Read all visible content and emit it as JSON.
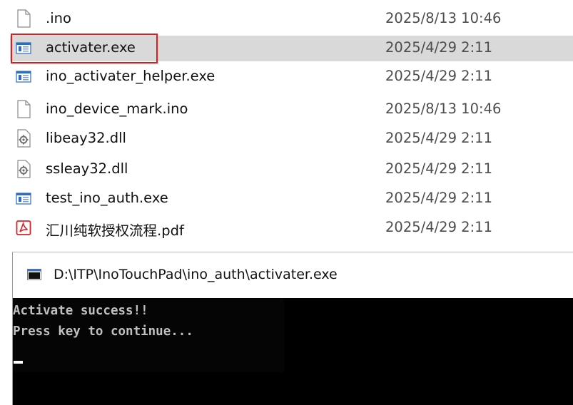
{
  "explorer": {
    "files": [
      {
        "name": ".ino",
        "date": "2025/8/13 10:46",
        "icon": "blank-file-icon"
      },
      {
        "name": "activater.exe",
        "date": "2025/4/29 2:11",
        "icon": "exe-window-icon",
        "selected": true
      },
      {
        "name": "ino_activater_helper.exe",
        "date": "2025/4/29 2:11",
        "icon": "exe-window-icon"
      },
      {
        "name": "ino_device_mark.ino",
        "date": "2025/8/13 10:46",
        "icon": "blank-file-icon"
      },
      {
        "name": "libeay32.dll",
        "date": "2025/4/29 2:11",
        "icon": "dll-gear-icon"
      },
      {
        "name": "ssleay32.dll",
        "date": "2025/4/29 2:11",
        "icon": "dll-gear-icon"
      },
      {
        "name": "test_ino_auth.exe",
        "date": "2025/4/29 2:11",
        "icon": "exe-window-icon"
      },
      {
        "name": "汇川纯软授权流程.pdf",
        "date": "2025/4/29 2:11",
        "icon": "pdf-icon"
      }
    ],
    "highlight_color": "#e81818",
    "selection_color": "#d9d9d9"
  },
  "console": {
    "title": "D:\\ITP\\InoTouchPad\\ino_auth\\activater.exe",
    "title_icon": "console-window-icon",
    "lines": [
      "Activate success!!",
      "Press key to continue..."
    ],
    "background_color": "#000000",
    "text_color": "#c0c0c0"
  }
}
